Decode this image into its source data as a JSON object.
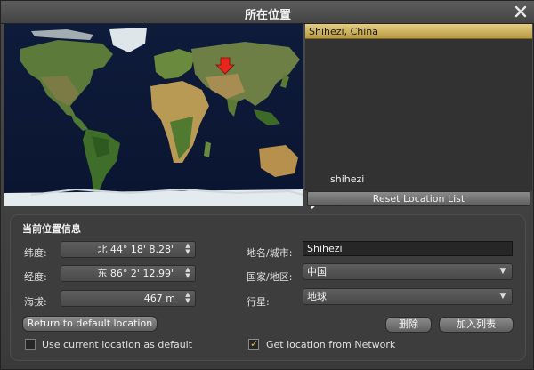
{
  "window": {
    "title": "所在位置"
  },
  "results": {
    "items": [
      "Shihezi, China"
    ]
  },
  "search": {
    "value": "shihezi"
  },
  "reset_button": "Reset Location List",
  "info": {
    "section_title": "当前位置信息",
    "latitude_label": "纬度:",
    "latitude_value": "北 44° 18' 8.28\"",
    "longitude_label": "经度:",
    "longitude_value": "东 86° 2' 12.99\"",
    "altitude_label": "海拔:",
    "altitude_value": "467 m",
    "city_label": "地名/城市:",
    "city_value": "Shihezi",
    "country_label": "国家/地区:",
    "country_value": "中国",
    "planet_label": "行星:",
    "planet_value": "地球",
    "return_button": "Return to default location",
    "delete_button": "删除",
    "add_button": "加入列表",
    "use_current_label": "Use current location as default",
    "use_current_checked": false,
    "get_network_label": "Get location from Network",
    "get_network_checked": true
  },
  "colors": {
    "accent": "#d9bb66",
    "marker": "#e8261c"
  },
  "icons": {
    "close": "close-icon",
    "search": "search-icon",
    "marker": "location-marker-icon"
  }
}
